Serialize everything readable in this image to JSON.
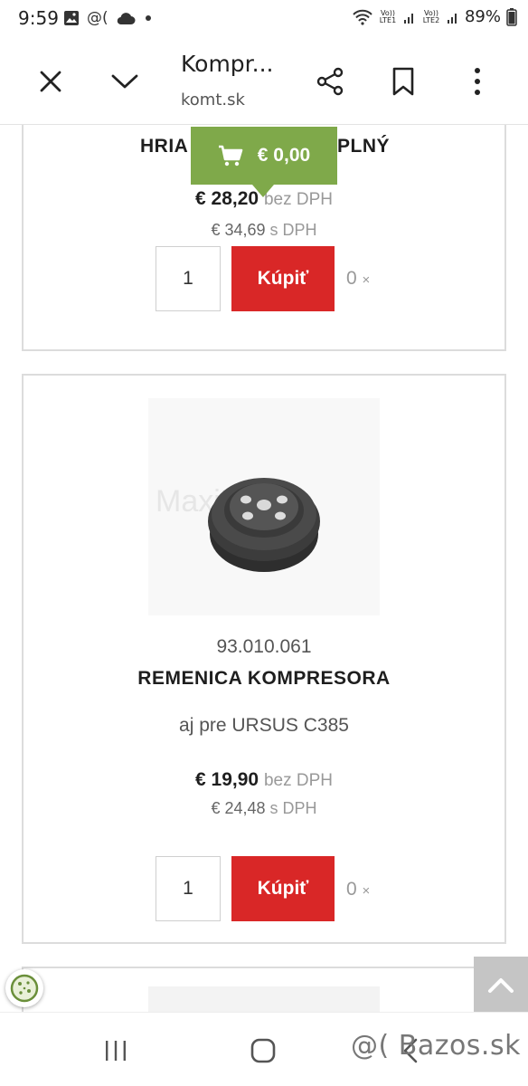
{
  "status_bar": {
    "time": "9:59",
    "battery": "89%",
    "network1": "Vo)) LTE1",
    "network2": "Vo)) LTE2",
    "icons": [
      "gallery-icon",
      "at-icon",
      "cloud-icon",
      "dot-icon",
      "wifi-icon",
      "signal-icon",
      "battery-icon"
    ]
  },
  "browser": {
    "title": "Kompr...",
    "domain": "komt.sk",
    "icons": [
      "close-icon",
      "chevron-down-icon",
      "share-icon",
      "bookmark-icon",
      "more-icon"
    ]
  },
  "cart": {
    "total": "€ 0,00",
    "icon": "cart-icon",
    "color": "#7fa94a"
  },
  "products": [
    {
      "name_visible_left": "HRIA",
      "name_visible_right": "PLNÝ",
      "price_net": "€ 28,20",
      "price_net_label": "bez DPH",
      "price_gross": "€ 34,69",
      "price_gross_label": "s DPH",
      "quantity": "1",
      "buy_label": "Kúpiť",
      "in_cart": "0",
      "in_cart_suffix": "×"
    },
    {
      "code": "93.010.061",
      "name": "REMENICA KOMPRESORA",
      "description": "aj pre URSUS C385",
      "price_net": "€ 19,90",
      "price_net_label": "bez DPH",
      "price_gross": "€ 24,48",
      "price_gross_label": "s DPH",
      "quantity": "1",
      "buy_label": "Kúpiť",
      "in_cart": "0",
      "in_cart_suffix": "×"
    }
  ],
  "colors": {
    "buy_button": "#d92727",
    "cart_bubble": "#7fa94a",
    "card_border": "#dcdcdc"
  },
  "watermark": "@( Bazos.sk"
}
